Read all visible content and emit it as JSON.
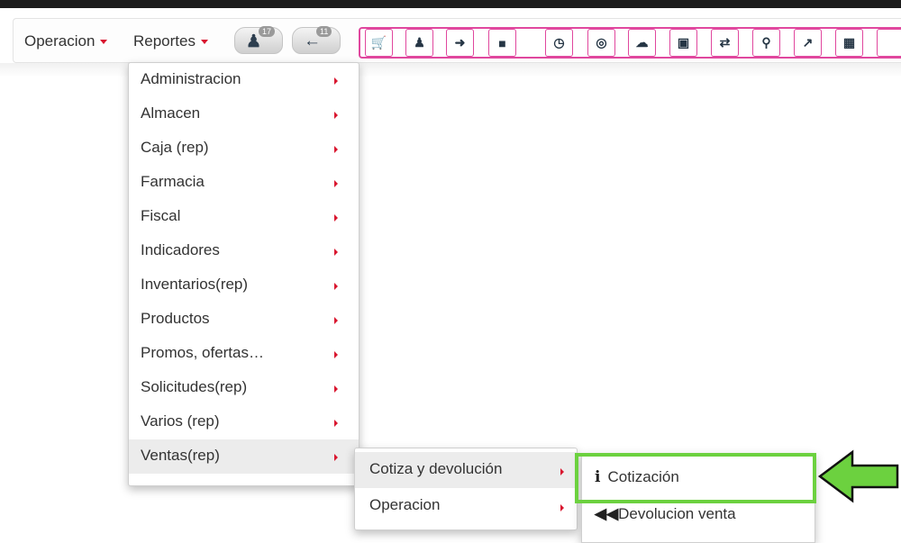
{
  "navbar": {
    "operacion_label": "Operacion",
    "reportes_label": "Reportes",
    "pill1_badge": "17",
    "pill2_badge": "11"
  },
  "toolbar": {
    "icons": [
      "cart-icon",
      "user-icon",
      "sign-in-icon",
      "building-icon",
      "clock-icon",
      "globe-icon",
      "cloud-upload-icon",
      "truck-icon",
      "exchange-icon",
      "map-marker-icon",
      "external-link-icon",
      "image-icon"
    ]
  },
  "reportes_menu": {
    "items": [
      {
        "label": "Administracion"
      },
      {
        "label": "Almacen"
      },
      {
        "label": "Caja (rep)"
      },
      {
        "label": "Farmacia"
      },
      {
        "label": "Fiscal"
      },
      {
        "label": "Indicadores"
      },
      {
        "label": "Inventarios(rep)"
      },
      {
        "label": "Productos"
      },
      {
        "label": "Promos, ofertas…"
      },
      {
        "label": "Solicitudes(rep)"
      },
      {
        "label": "Varios (rep)"
      },
      {
        "label": "Ventas(rep)"
      }
    ]
  },
  "ventas_submenu": {
    "items": [
      {
        "label": "Cotiza y devolución"
      },
      {
        "label": "Operacion"
      }
    ]
  },
  "cotiza_submenu": {
    "cotizacion_icon": "i",
    "cotizacion_label": "Cotización",
    "devolucion_icon": "◀◀",
    "devolucion_label": "Devolucion venta"
  },
  "colors": {
    "accent_pink": "#e0479e",
    "caret_red": "#d9162f",
    "highlight_green": "#6cd13f"
  }
}
